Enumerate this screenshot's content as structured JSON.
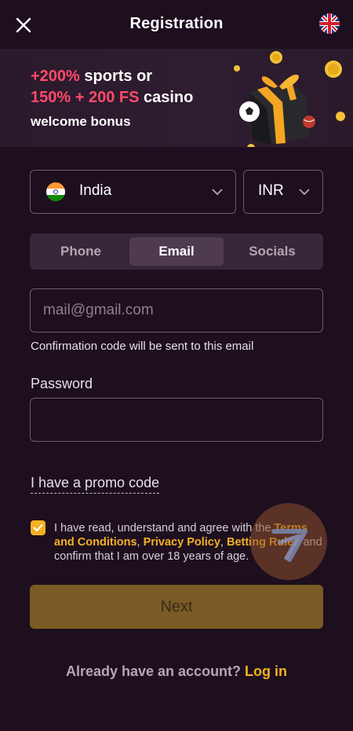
{
  "header": {
    "title": "Registration",
    "close_icon": "close-icon",
    "language_flag_icon": "uk-flag-icon"
  },
  "banner": {
    "line1_accent": "+200%",
    "line1_rest": " sports or",
    "line2_accent": "150% + 200 FS",
    "line2_rest": " casino",
    "line3": "welcome bonus"
  },
  "country_select": {
    "flag_icon": "india-flag-icon",
    "value": "India"
  },
  "currency_select": {
    "value": "INR"
  },
  "tabs": [
    {
      "label": "Phone",
      "active": false
    },
    {
      "label": "Email",
      "active": true
    },
    {
      "label": "Socials",
      "active": false
    }
  ],
  "email": {
    "value": "",
    "placeholder": "mail@gmail.com",
    "hint": "Confirmation code will be sent to this email"
  },
  "password": {
    "label": "Password",
    "value": ""
  },
  "promo_link": "I have a promo code",
  "agreement": {
    "checked": true,
    "text1": "I have read, understand and agree with the ",
    "terms": "Terms and Conditions",
    "sep1": ", ",
    "privacy": "Privacy Policy",
    "sep2": ", ",
    "betting": "Betting Rules",
    "text2": " and confirm that I am over 18 years of age."
  },
  "next_button": "Next",
  "footer": {
    "question": "Already have an account? ",
    "login": "Log in"
  },
  "colors": {
    "background": "#1d0f1e",
    "accent_gold": "#f4b122",
    "accent_red": "#ff4a6b",
    "button_disabled": "#7a5a25"
  }
}
